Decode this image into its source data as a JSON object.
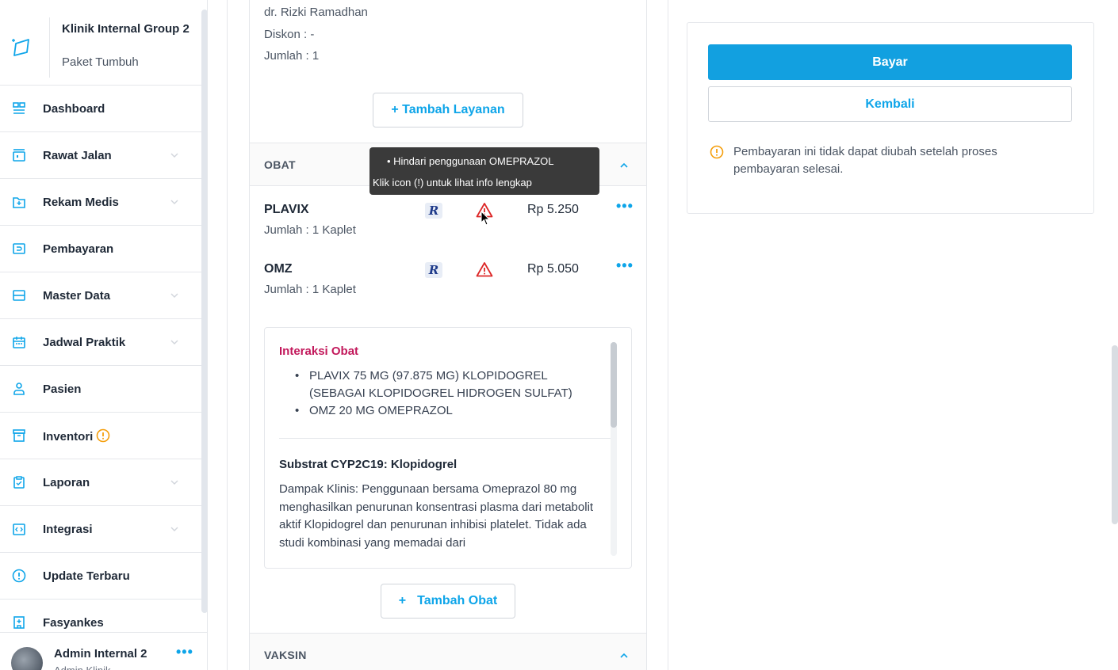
{
  "sidebar": {
    "clinic_name": "Klinik Internal Group 2",
    "clinic_plan": "Paket Tumbuh",
    "items": [
      {
        "label": "Dashboard",
        "icon": "dashboard-icon",
        "has_chevron": false
      },
      {
        "label": "Rawat Jalan",
        "icon": "outpatient-icon",
        "has_chevron": true
      },
      {
        "label": "Rekam Medis",
        "icon": "medical-record-icon",
        "has_chevron": true
      },
      {
        "label": "Pembayaran",
        "icon": "payment-icon",
        "has_chevron": false
      },
      {
        "label": "Master Data",
        "icon": "master-data-icon",
        "has_chevron": true
      },
      {
        "label": "Jadwal Praktik",
        "icon": "calendar-icon",
        "has_chevron": true
      },
      {
        "label": "Pasien",
        "icon": "patient-icon",
        "has_chevron": false
      },
      {
        "label": "Inventori",
        "icon": "inventory-icon",
        "has_chevron": false,
        "warning": true
      },
      {
        "label": "Laporan",
        "icon": "report-icon",
        "has_chevron": true
      },
      {
        "label": "Integrasi",
        "icon": "integration-icon",
        "has_chevron": true
      },
      {
        "label": "Update Terbaru",
        "icon": "info-circle-icon",
        "has_chevron": false
      },
      {
        "label": "Fasyankes",
        "icon": "facility-icon",
        "has_chevron": false
      }
    ],
    "user": {
      "name": "Admin Internal 2",
      "role": "Admin Klinik"
    }
  },
  "service": {
    "doctor": "dr. Rizki Ramadhan",
    "discount": "Diskon : -",
    "quantity": "Jumlah : 1",
    "add_service_label": "+ Tambah Layanan"
  },
  "medicine": {
    "section_title": "OBAT",
    "items": [
      {
        "name": "PLAVIX",
        "qty": "Jumlah : 1 Kaplet",
        "price": "Rp 5.250"
      },
      {
        "name": "OMZ",
        "qty": "Jumlah : 1 Kaplet",
        "price": "Rp 5.050"
      }
    ],
    "rx_symbol": "R",
    "more_symbol": "•••",
    "interaction": {
      "title": "Interaksi Obat",
      "drugs": [
        "PLAVIX 75 MG (97.875 MG) KLOPIDOGREL (SEBAGAI KLOPIDOGREL HIDROGEN SULFAT)",
        "OMZ 20 MG OMEPRAZOL"
      ],
      "subtitle": "Substrat CYP2C19: Klopidogrel",
      "description": "Dampak Klinis: Penggunaan bersama Omeprazol 80 mg menghasilkan penurunan konsentrasi plasma dari metabolit aktif Klopidogrel dan penurunan inhibisi platelet. Tidak ada studi kombinasi yang memadai dari"
    },
    "add_medicine_label": "Tambah Obat",
    "add_plus": "+"
  },
  "tooltip": {
    "line1": "Hindari penggunaan OMEPRAZOL",
    "line2": "Klik icon (!) untuk lihat info lengkap"
  },
  "vaccine": {
    "section_title": "VAKSIN"
  },
  "payment": {
    "pay_label": "Bayar",
    "back_label": "Kembali",
    "note": "Pembayaran ini tidak dapat diubah setelah proses pembayaran selesai."
  },
  "colors": {
    "accent": "#0ea5e9",
    "primary_button": "#12a0e0",
    "warning": "#f59e0b",
    "alert": "#dc2626",
    "interaction_title": "#c2185b"
  }
}
